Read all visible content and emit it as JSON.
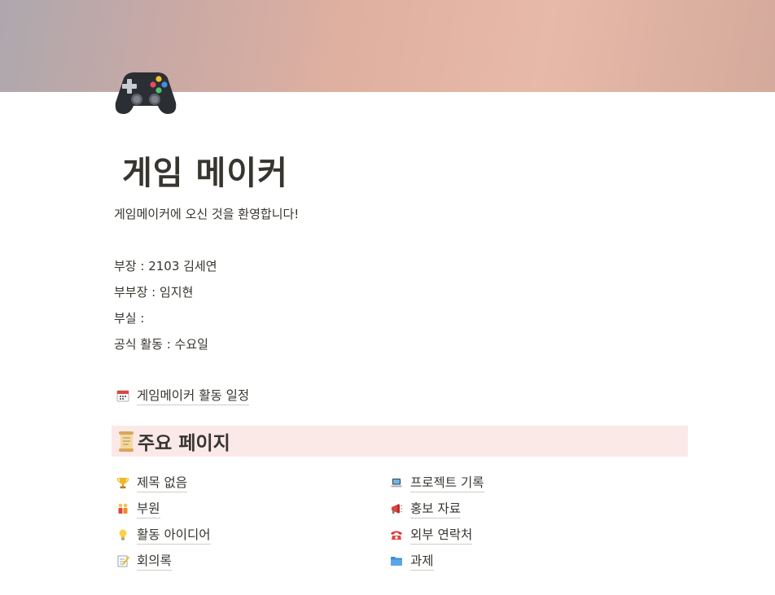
{
  "page": {
    "icon": "game-controller-icon",
    "title": "게임 메이커",
    "welcome": "게임메이커에 오신 것을 환영합니다!",
    "info": [
      "부장 : 2103 김세연",
      "부부장 : 임지현",
      "부실 :",
      "공식 활동 : 수요일"
    ],
    "schedule_link": {
      "icon": "calendar-icon",
      "label": "게임메이커 활동 일정"
    },
    "section_heading": {
      "icon": "scroll-icon",
      "label": "주요 페이지"
    },
    "left_links": [
      {
        "icon": "trophy-icon",
        "label": "제목 없음"
      },
      {
        "icon": "people-icon",
        "label": "부원"
      },
      {
        "icon": "lightbulb-icon",
        "label": "활동 아이디어"
      },
      {
        "icon": "memo-icon",
        "label": "회의록"
      }
    ],
    "right_links": [
      {
        "icon": "laptop-icon",
        "label": "프로젝트 기록"
      },
      {
        "icon": "megaphone-icon",
        "label": "홍보 자료"
      },
      {
        "icon": "telephone-icon",
        "label": "외부 연락처"
      },
      {
        "icon": "folder-icon",
        "label": "과제"
      }
    ]
  },
  "colors": {
    "text": "#37352f",
    "heading_background": "#fbe9e8"
  }
}
